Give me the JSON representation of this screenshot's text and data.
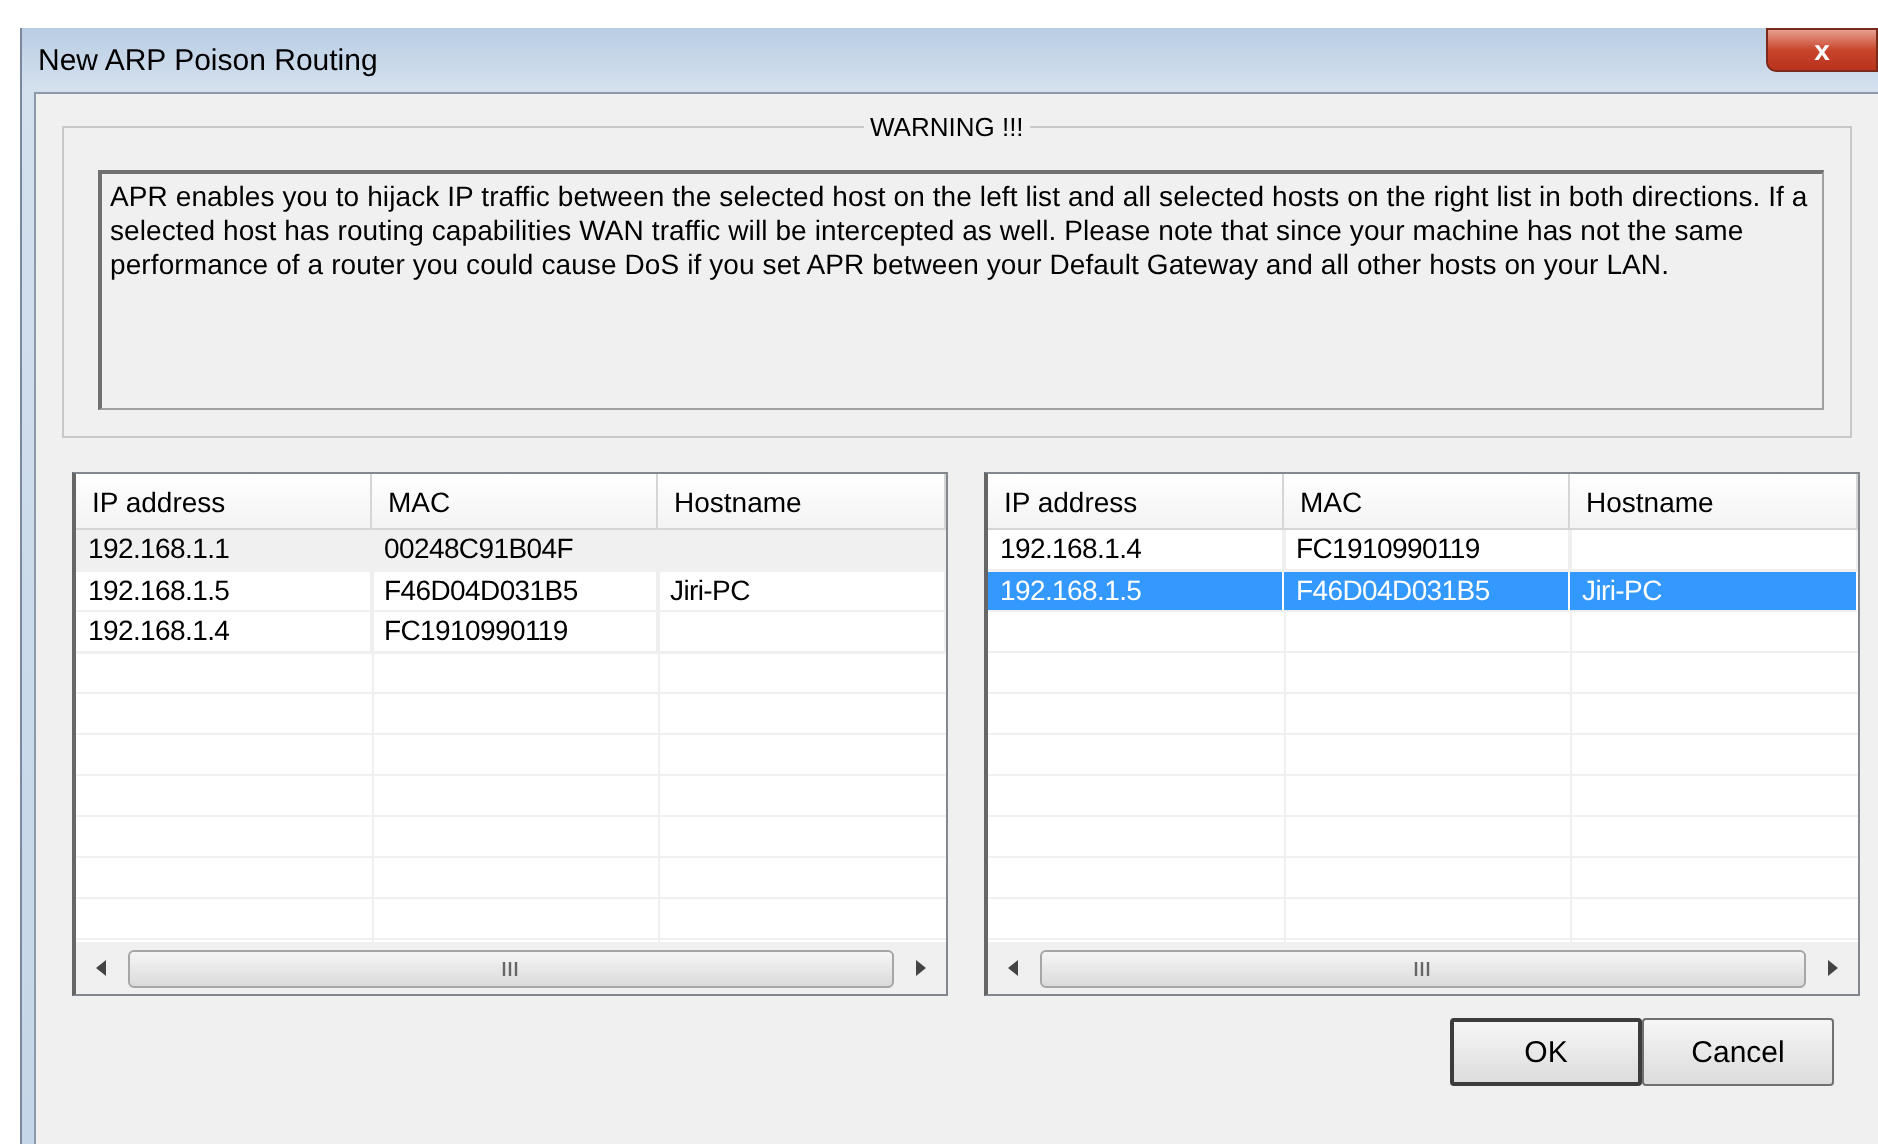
{
  "window": {
    "title": "New ARP Poison Routing",
    "close": "x"
  },
  "warning": {
    "title": "WARNING !!!",
    "text": "APR enables you to hijack IP traffic between the selected host on the left list and all selected hosts on the right list in both directions. If a selected host has routing capabilities WAN traffic will be intercepted as well. Please note that since your machine has not the same performance of a router you could cause DoS if you set APR between your Default Gateway and all other hosts on your LAN."
  },
  "lists": [
    {
      "columns": [
        "IP address",
        "MAC",
        "Hostname"
      ],
      "focused": false,
      "rows": [
        {
          "cells": [
            "192.168.1.1",
            "00248C91B04F",
            ""
          ],
          "selected": true
        },
        {
          "cells": [
            "192.168.1.5",
            "F46D04D031B5",
            "Jiri-PC"
          ],
          "selected": false
        },
        {
          "cells": [
            "192.168.1.4",
            "FC1910990119",
            ""
          ],
          "selected": false
        }
      ]
    },
    {
      "columns": [
        "IP address",
        "MAC",
        "Hostname"
      ],
      "focused": true,
      "rows": [
        {
          "cells": [
            "192.168.1.4",
            "FC1910990119",
            ""
          ],
          "selected": false
        },
        {
          "cells": [
            "192.168.1.5",
            "F46D04D031B5",
            "Jiri-PC"
          ],
          "selected": true
        }
      ]
    }
  ],
  "buttons": [
    "OK",
    "Cancel"
  ]
}
